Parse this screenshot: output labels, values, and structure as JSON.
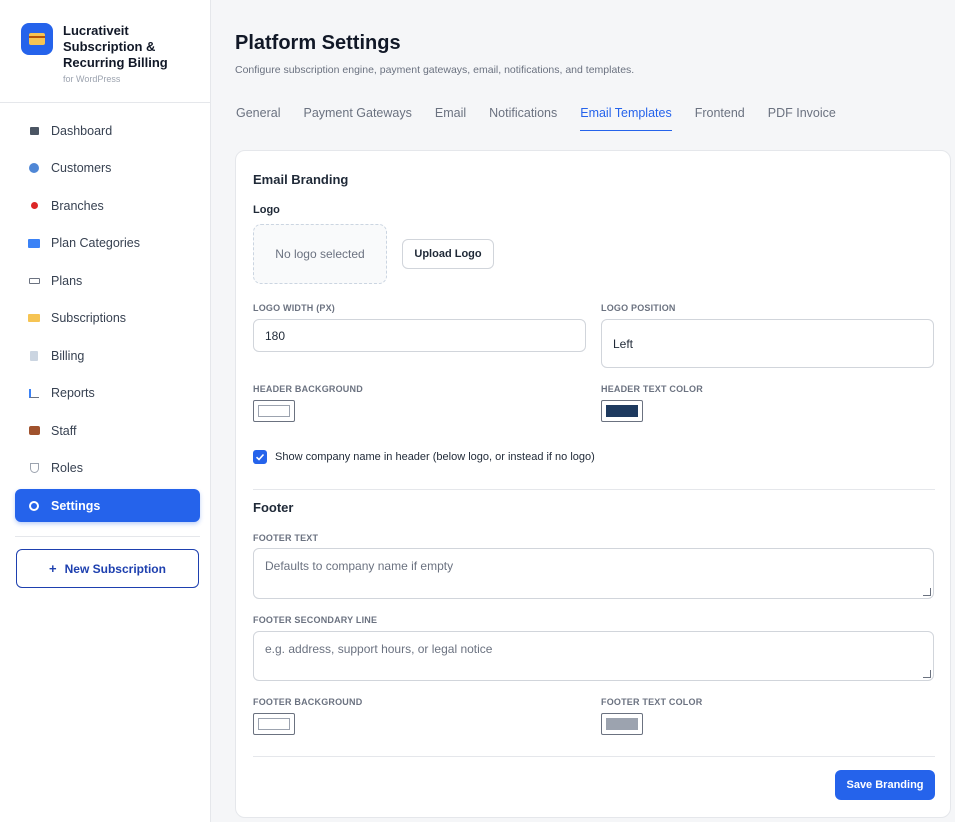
{
  "brand": {
    "name": "Lucrativeit Subscription & Recurring Billing",
    "sub": "for WordPress",
    "accent": "#2563eb"
  },
  "sidebar": {
    "items": [
      {
        "label": "Dashboard",
        "icon": "dashboard-icon"
      },
      {
        "label": "Customers",
        "icon": "customers-icon"
      },
      {
        "label": "Branches",
        "icon": "pin-icon"
      },
      {
        "label": "Plan Categories",
        "icon": "folder-icon"
      },
      {
        "label": "Plans",
        "icon": "tag-icon"
      },
      {
        "label": "Subscriptions",
        "icon": "credit-card-icon"
      },
      {
        "label": "Billing",
        "icon": "receipt-icon"
      },
      {
        "label": "Reports",
        "icon": "bar-chart-icon"
      },
      {
        "label": "Staff",
        "icon": "briefcase-icon"
      },
      {
        "label": "Roles",
        "icon": "shield-icon"
      },
      {
        "label": "Settings",
        "icon": "gear-icon",
        "active": true
      }
    ],
    "new_subscription": "New Subscription",
    "new_subscription_icon": "+"
  },
  "header": {
    "title": "Platform Settings",
    "subtitle": "Configure subscription engine, payment gateways, email, notifications, and templates."
  },
  "tabs": [
    {
      "label": "General"
    },
    {
      "label": "Payment Gateways"
    },
    {
      "label": "Email"
    },
    {
      "label": "Notifications"
    },
    {
      "label": "Email Templates",
      "active": true
    },
    {
      "label": "Frontend"
    },
    {
      "label": "PDF Invoice"
    }
  ],
  "branding": {
    "section_title": "Email Branding",
    "logo_label": "Logo",
    "logo_placeholder": "No logo selected",
    "upload_label": "Upload Logo",
    "logo_width_label": "Logo Width (px)",
    "logo_width_value": "180",
    "logo_position_label": "Logo Position",
    "logo_position_value": "Left",
    "header_bg_label": "Header Background",
    "header_bg_color": "#ffffff",
    "header_text_label": "Header Text Color",
    "header_text_color": "#1e3a5f",
    "show_company_label": "Show company name in header (below logo, or instead if no logo)",
    "show_company_checked": true
  },
  "footer": {
    "section_title": "Footer",
    "footer_text_label": "Footer Text",
    "footer_text_placeholder": "Defaults to company name if empty",
    "footer_secondary_label": "Footer Secondary Line",
    "footer_secondary_placeholder": "e.g. address, support hours, or legal notice",
    "footer_bg_label": "Footer Background",
    "footer_bg_color": "#ffffff",
    "footer_text_color_label": "Footer Text Color",
    "footer_text_color": "#9ca3af"
  },
  "actions": {
    "save_label": "Save Branding"
  }
}
